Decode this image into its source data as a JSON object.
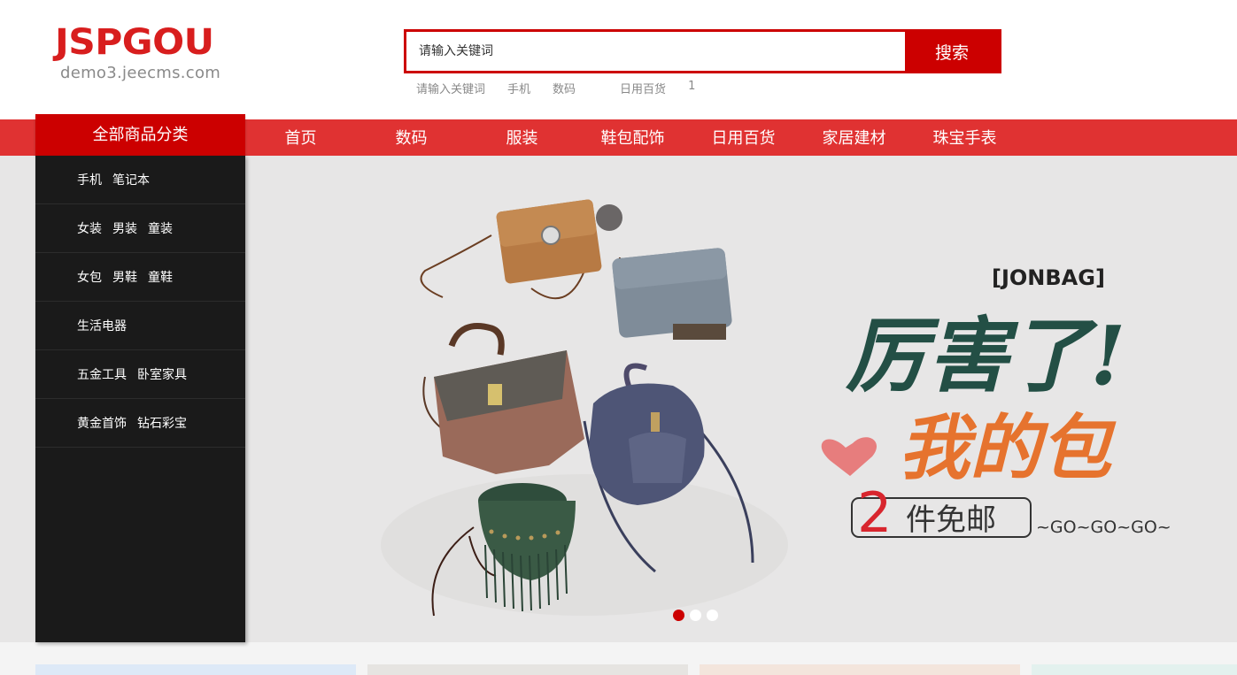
{
  "header": {
    "logo_main": "JSPGOU",
    "logo_sub": "demo3.jeecms.com",
    "search_placeholder": "请输入关键词",
    "search_button": "搜索",
    "hot_words": [
      "请输入关键词",
      "手机",
      "数码",
      "日用百货",
      "1"
    ]
  },
  "nav": {
    "category_title": "全部商品分类",
    "items": [
      "首页",
      "数码",
      "服装",
      "鞋包配饰",
      "日用百货",
      "家居建材",
      "珠宝手表"
    ]
  },
  "categories": [
    [
      "手机",
      "笔记本"
    ],
    [
      "女装",
      "男装",
      "童装"
    ],
    [
      "女包",
      "男鞋",
      "童鞋"
    ],
    [
      "生活电器"
    ],
    [
      "五金工具",
      "卧室家具"
    ],
    [
      "黄金首饰",
      "钻石彩宝"
    ]
  ],
  "banner": {
    "brand": "[JONBAG]",
    "headline_1": "厉害了!",
    "headline_2": "我的包",
    "offer_num": "2",
    "offer_text": "件免邮",
    "tagline": "~GO~GO~GO~",
    "slide_count": 3,
    "active_slide": 1
  },
  "colors": {
    "brand_red": "#c00",
    "nav_red": "#e03232",
    "sidebar_bg": "#1a1a1a",
    "banner_bg": "#e7e6e6"
  }
}
